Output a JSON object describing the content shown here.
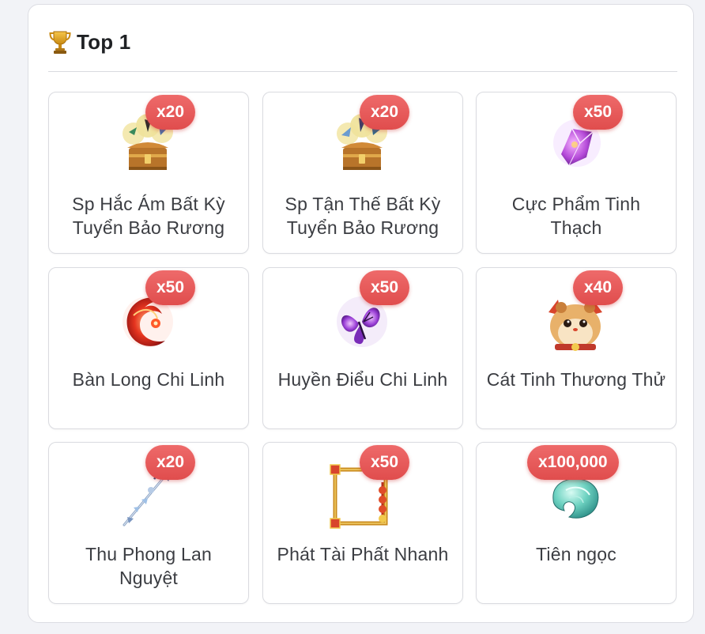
{
  "section": {
    "icon": "trophy-icon",
    "title": "Top 1"
  },
  "items": [
    {
      "name": "Sp Hắc Ám Bất Kỳ Tuyển Bảo Rương",
      "quantity": "x20",
      "icon": "dark-treasure-chest-icon"
    },
    {
      "name": "Sp Tận Thế Bất Kỳ Tuyển Bảo Rương",
      "quantity": "x20",
      "icon": "doom-treasure-chest-icon"
    },
    {
      "name": "Cực Phẩm Tinh Thạch",
      "quantity": "x50",
      "icon": "purple-crystal-icon"
    },
    {
      "name": "Bàn Long Chi Linh",
      "quantity": "x50",
      "icon": "red-dragon-spirit-icon"
    },
    {
      "name": "Huyền Điểu Chi Linh",
      "quantity": "x50",
      "icon": "purple-butterfly-spirit-icon"
    },
    {
      "name": "Cát Tinh Thương Thử",
      "quantity": "x40",
      "icon": "hamster-icon"
    },
    {
      "name": "Thu Phong Lan Nguyệt",
      "quantity": "x20",
      "icon": "spear-weapon-icon"
    },
    {
      "name": "Phát Tài Phất Nhanh",
      "quantity": "x50",
      "icon": "golden-frame-icon"
    },
    {
      "name": "Tiên ngọc",
      "quantity": "x100,000",
      "icon": "jade-gem-icon"
    }
  ],
  "colors": {
    "badge": "#e4534f",
    "border": "#dadbe0",
    "text": "#3b3d42"
  }
}
